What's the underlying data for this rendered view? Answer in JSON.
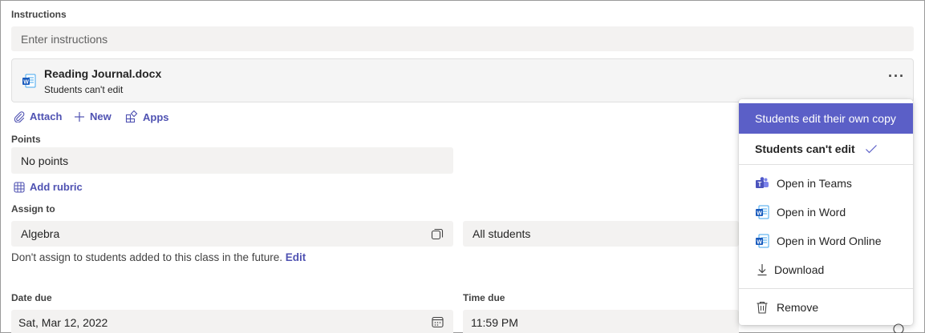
{
  "instructions": {
    "label": "Instructions",
    "placeholder": "Enter instructions"
  },
  "attachment": {
    "file_name": "Reading Journal.docx",
    "permission": "Students can't edit",
    "more_label": "···"
  },
  "toolbar": {
    "attach_label": "Attach",
    "new_label": "New",
    "apps_label": "Apps"
  },
  "points": {
    "label": "Points",
    "value": "No points",
    "add_rubric_label": "Add rubric"
  },
  "assign": {
    "label": "Assign to",
    "class_value": "Algebra",
    "students_value": "All students",
    "note": "Don't assign to students added to this class in the future.",
    "edit_label": "Edit"
  },
  "due": {
    "date_label": "Date due",
    "date_value": "Sat, Mar 12, 2022",
    "time_label": "Time due",
    "time_value": "11:59 PM"
  },
  "menu": {
    "edit_own_copy": "Students edit their own copy",
    "cant_edit": "Students can't edit",
    "open_teams": "Open in Teams",
    "open_word": "Open in Word",
    "open_word_online": "Open in Word Online",
    "download": "Download",
    "remove": "Remove"
  },
  "colors": {
    "accent": "#5b5fc7",
    "link": "#4f52b2",
    "word_blue": "#185abd",
    "teams_purple": "#5059c9"
  }
}
